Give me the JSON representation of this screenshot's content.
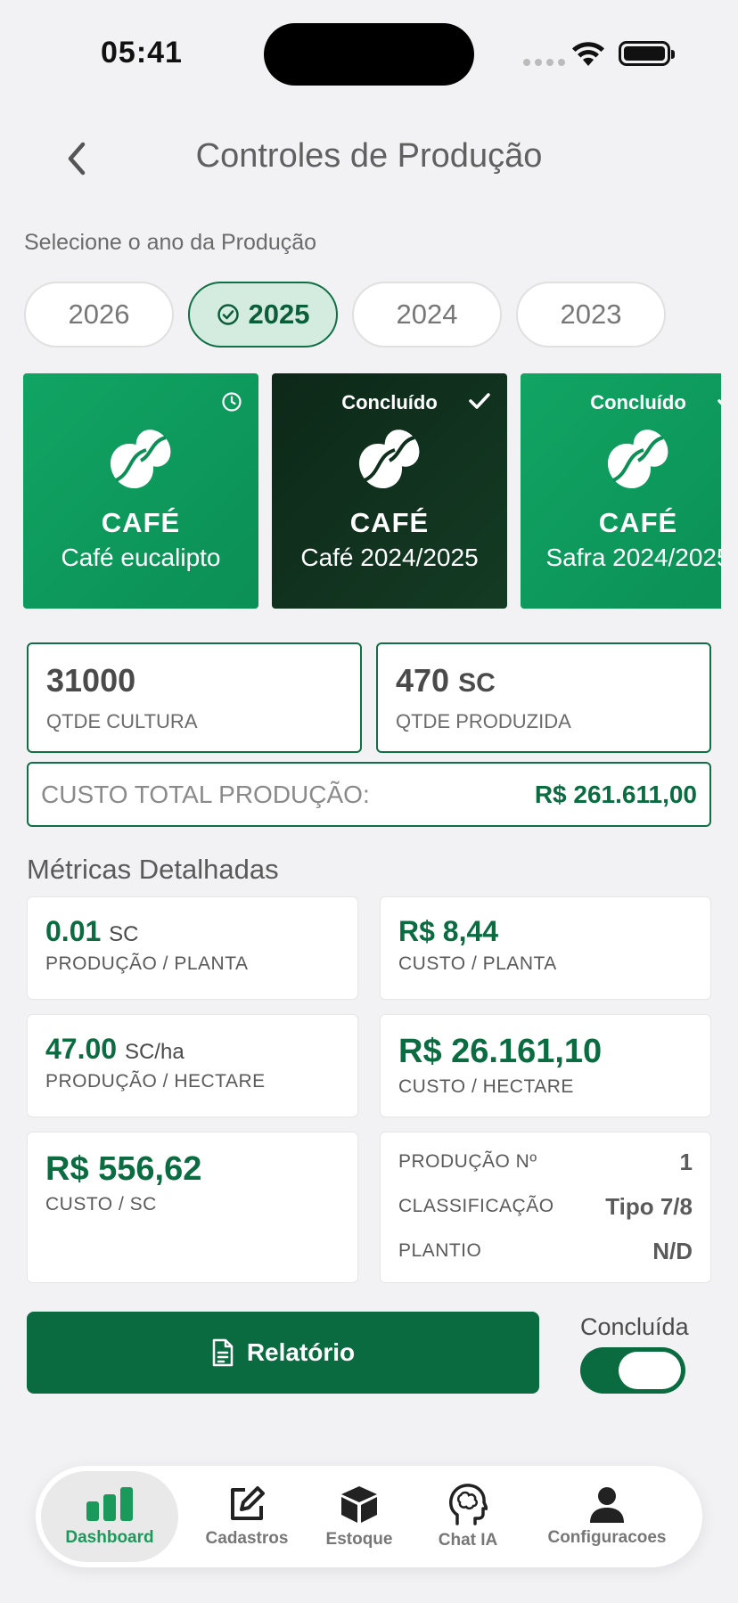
{
  "status": {
    "time": "05:41"
  },
  "header": {
    "title": "Controles de Produção"
  },
  "year_section": {
    "label": "Selecione o ano da Produção",
    "years": [
      "2026",
      "2025",
      "2024",
      "2023"
    ],
    "selected": "2025"
  },
  "cards": [
    {
      "badge": "",
      "crop": "CAFÉ",
      "name": "Café eucalipto"
    },
    {
      "badge": "Concluído",
      "crop": "CAFÉ",
      "name": "Café 2024/2025"
    },
    {
      "badge": "Concluído",
      "crop": "CAFÉ",
      "name": "Safra 2024/2025"
    }
  ],
  "stats": {
    "qtde_cultura": {
      "value": "31000",
      "label": "QTDE CULTURA"
    },
    "qtde_produzida": {
      "value": "470",
      "unit": "SC",
      "label": "QTDE PRODUZIDA"
    },
    "custo_total": {
      "label": "CUSTO TOTAL PRODUÇÃO:",
      "value": "R$ 261.611,00"
    }
  },
  "metrics": {
    "title": "Métricas Detalhadas",
    "producao_planta": {
      "value": "0.01",
      "unit": "SC",
      "label": "PRODUÇÃO / PLANTA"
    },
    "custo_planta": {
      "value": "R$ 8,44",
      "label": "CUSTO / PLANTA"
    },
    "producao_hectare": {
      "value": "47.00",
      "unit": "SC/ha",
      "label": "PRODUÇÃO / HECTARE"
    },
    "custo_hectare": {
      "value": "R$ 26.161,10",
      "label": "CUSTO / HECTARE"
    },
    "custo_sc": {
      "value": "R$ 556,62",
      "label": "CUSTO / SC"
    },
    "info": [
      {
        "key": "PRODUÇÃO Nº",
        "value": "1"
      },
      {
        "key": "CLASSIFICAÇÃO",
        "value": "Tipo 7/8"
      },
      {
        "key": "PLANTIO",
        "value": "N/D"
      }
    ]
  },
  "actions": {
    "report_label": "Relatório",
    "done_label": "Concluída",
    "done_on": true
  },
  "tabs": [
    "Dashboard",
    "Cadastros",
    "Estoque",
    "Chat IA",
    "Configuracoes"
  ],
  "colors": {
    "accent": "#0a6b41",
    "card_green": "#11a463",
    "card_dark": "#0d2818"
  }
}
